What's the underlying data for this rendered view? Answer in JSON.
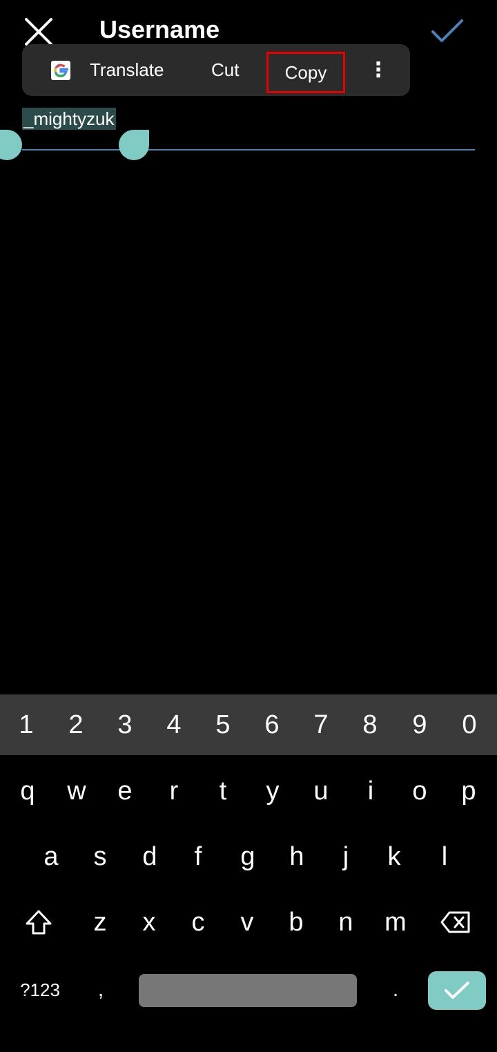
{
  "header": {
    "title": "Username",
    "close_icon": "close-icon",
    "confirm_icon": "checkmark-icon",
    "confirm_color": "#4b83b8"
  },
  "context_menu": {
    "google_icon": "google-g-icon",
    "translate": "Translate",
    "cut": "Cut",
    "copy": "Copy",
    "more": "⋮",
    "highlight_color": "#e60000"
  },
  "field": {
    "value": "_mightyzuk",
    "selection_color": "#2a4b49",
    "handle_color": "#80cbc4"
  },
  "keyboard": {
    "numbers": [
      "1",
      "2",
      "3",
      "4",
      "5",
      "6",
      "7",
      "8",
      "9",
      "0"
    ],
    "row1": [
      "q",
      "w",
      "e",
      "r",
      "t",
      "y",
      "u",
      "i",
      "o",
      "p"
    ],
    "row2": [
      "a",
      "s",
      "d",
      "f",
      "g",
      "h",
      "j",
      "k",
      "l"
    ],
    "row3": [
      "z",
      "x",
      "c",
      "v",
      "b",
      "n",
      "m"
    ],
    "symbols": "?123",
    "comma": ",",
    "period": ".",
    "shift_icon": "shift-icon",
    "backspace_icon": "backspace-icon",
    "enter_icon": "checkmark-icon"
  }
}
